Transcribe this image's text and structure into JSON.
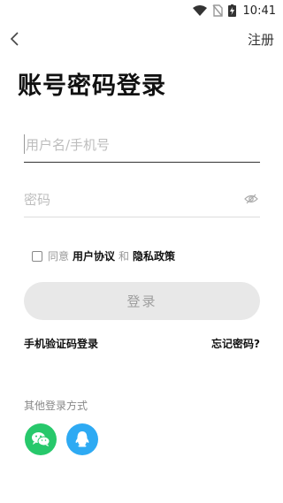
{
  "status_bar": {
    "time": "10:41"
  },
  "nav": {
    "register_label": "注册"
  },
  "title": "账号密码登录",
  "form": {
    "username_placeholder": "用户名/手机号",
    "password_placeholder": "密码"
  },
  "agreement": {
    "prefix": "同意",
    "user_agreement": "用户协议",
    "and": "和",
    "privacy_policy": "隐私政策",
    "checked": false
  },
  "login_button": "登录",
  "sms_login": "手机验证码登录",
  "forgot_password": "忘记密码?",
  "other_login_label": "其他登录方式",
  "social_logins": [
    {
      "name": "wechat",
      "color": "#27c86b"
    },
    {
      "name": "qq",
      "color": "#2eaaf3"
    }
  ]
}
